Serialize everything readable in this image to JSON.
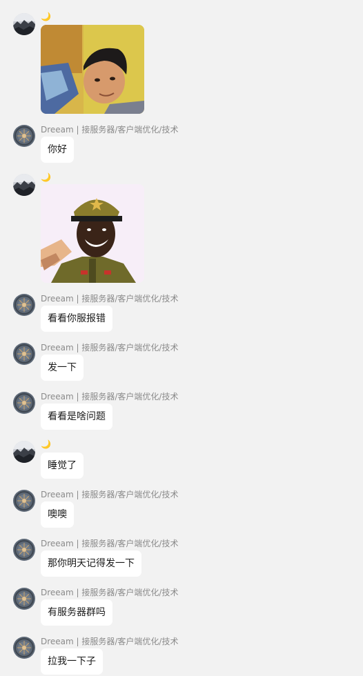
{
  "moon_emoji": "🌙",
  "sender_dreeam": "Dreeam | 接服务器/客户端优化/技术",
  "messages": [
    {
      "text": "你好"
    },
    {
      "text": "看看你服报错"
    },
    {
      "text": "发一下"
    },
    {
      "text": "看看是啥问题"
    },
    {
      "text": "睡觉了"
    },
    {
      "text": "噢噢"
    },
    {
      "text": "那你明天记得发一下"
    },
    {
      "text": "有服务器群吗"
    },
    {
      "text": "拉我一下子"
    }
  ],
  "colors": {
    "background": "#f2f2f2",
    "bubble": "#ffffff",
    "sender_name": "#8a8a8a",
    "text": "#1a1a1a"
  },
  "stickers": [
    {
      "icon": "sticker-man-lying-in-bed"
    },
    {
      "icon": "sticker-man-saluting-in-uniform"
    }
  ]
}
